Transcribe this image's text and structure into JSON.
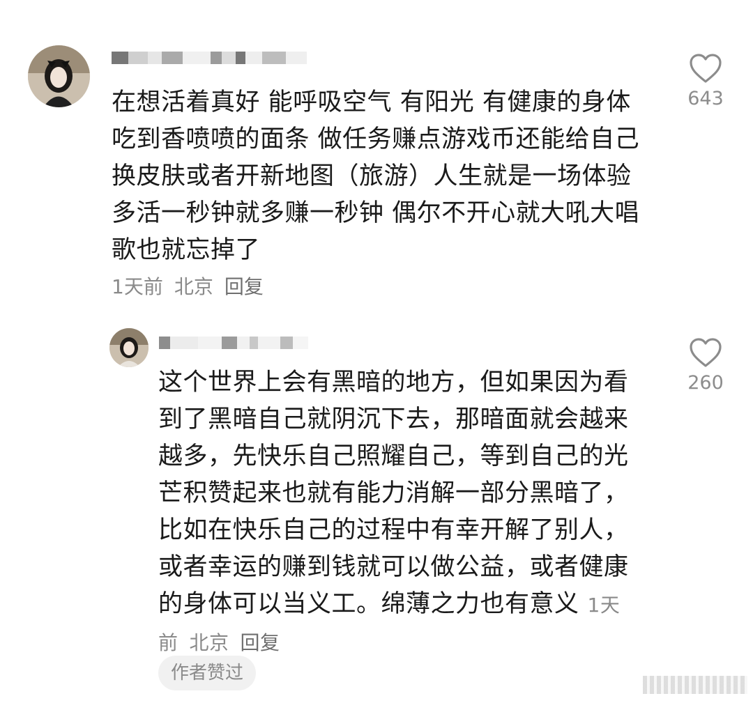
{
  "comments": [
    {
      "text": "在想活着真好 能呼吸空气 有阳光 有健康的身体吃到香喷喷的面条 做任务赚点游戏币还能给自己换皮肤或者开新地图（旅游）人生就是一场体验 多活一秒钟就多赚一秒钟 偶尔不开心就大吼大唱歌也就忘掉了",
      "time": "1天前",
      "location": "北京",
      "reply": "回复",
      "likes": "643",
      "heart_icon": "heart-outline-icon"
    },
    {
      "text": "这个世界上会有黑暗的地方，但如果因为看到了黑暗自己就阴沉下去，那暗面就会越来越多，先快乐自己照耀自己，等到自己的光芒积赞起来也就有能力消解一部分黑暗了，比如在快乐自己的过程中有幸开解了别人，或者幸运的赚到钱就可以做公益，或者健康的身体可以当义工。绵薄之力也有意义",
      "time": "1天前",
      "location": "北京",
      "reply": "回复",
      "likes": "260",
      "heart_icon": "heart-outline-icon",
      "badge": "作者赞过"
    }
  ],
  "colors": {
    "text": "#1a1a1a",
    "meta": "#8a8a8a",
    "badge_bg": "#f1f1f1"
  }
}
